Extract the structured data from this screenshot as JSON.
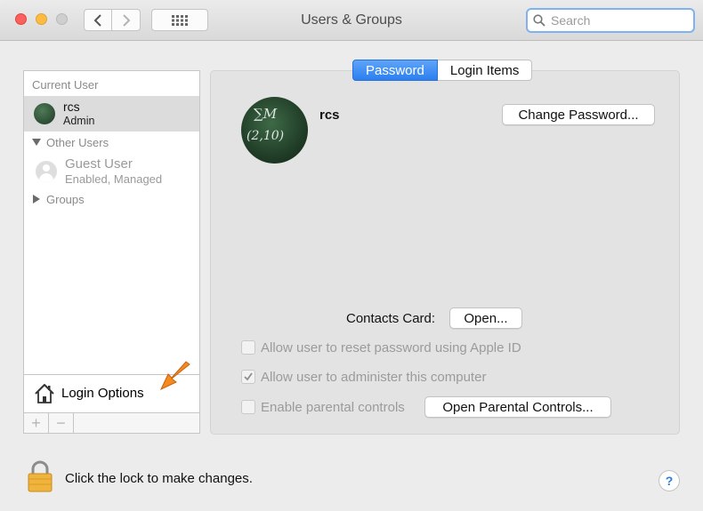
{
  "window": {
    "title": "Users & Groups",
    "search_placeholder": "Search"
  },
  "sidebar": {
    "current_user_header": "Current User",
    "current_user": {
      "name": "rcs",
      "role": "Admin"
    },
    "other_users_header": "Other Users",
    "other_users": [
      {
        "name": "Guest User",
        "status": "Enabled, Managed"
      }
    ],
    "groups_header": "Groups",
    "login_options_label": "Login Options",
    "add_label": "+",
    "remove_label": "−"
  },
  "tabs": [
    {
      "label": "Password",
      "active": true
    },
    {
      "label": "Login Items",
      "active": false
    }
  ],
  "main": {
    "user_name": "rcs",
    "avatar_text": [
      "∑M",
      "(2,10)"
    ],
    "change_password_label": "Change Password...",
    "contacts_card_label": "Contacts Card:",
    "open_label": "Open...",
    "checkboxes": [
      {
        "label": "Allow user to reset password using Apple ID",
        "checked": false
      },
      {
        "label": "Allow user to administer this computer",
        "checked": true
      },
      {
        "label": "Enable parental controls",
        "checked": false
      }
    ],
    "open_parental_controls_label": "Open Parental Controls..."
  },
  "footer": {
    "lock_text": "Click the lock to make changes.",
    "help_label": "?"
  },
  "colors": {
    "accent": "#2c7ff0",
    "traffic_red": "#fc615d",
    "traffic_yellow": "#fdbc40",
    "arrow_orange": "#f58a1f"
  }
}
